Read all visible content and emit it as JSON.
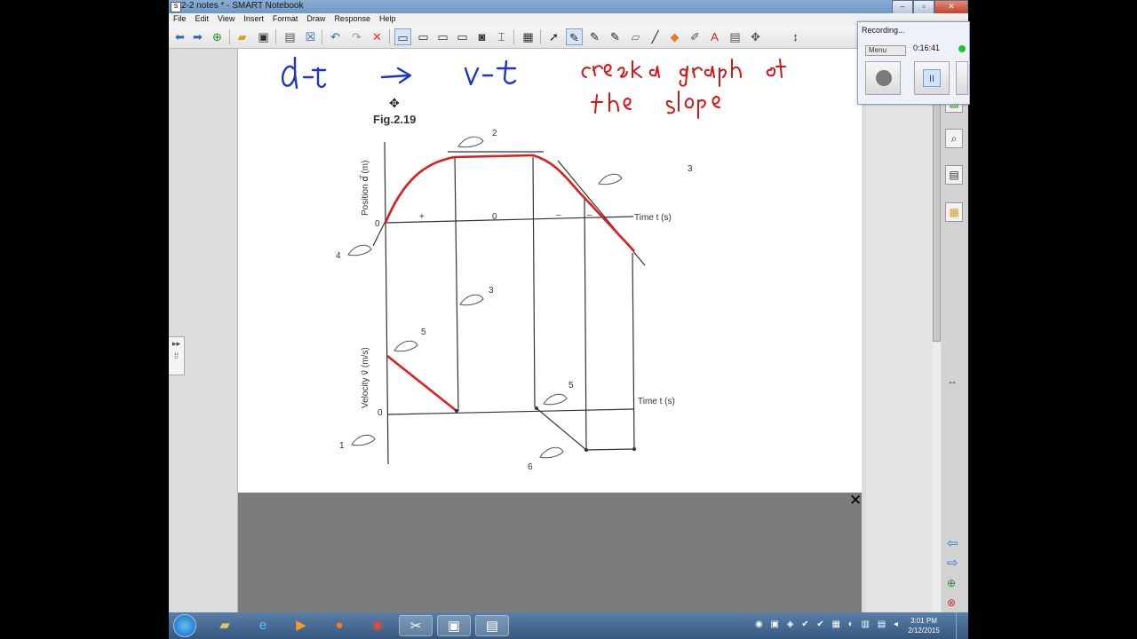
{
  "window": {
    "title": "2-2 notes * - SMART Notebook",
    "controls": {
      "minimize": "–",
      "maximize": "▫",
      "close": "✕"
    }
  },
  "menu": [
    "File",
    "Edit",
    "View",
    "Insert",
    "Format",
    "Draw",
    "Response",
    "Help"
  ],
  "toolbar_icons": [
    "back-arrow-icon",
    "forward-arrow-icon",
    "add-page-icon",
    "open-folder-icon",
    "save-icon",
    "paste-icon",
    "delete-page-icon",
    "undo-icon",
    "redo-icon",
    "delete-icon",
    "screen-shade-icon",
    "full-screen-icon",
    "dual-display-icon",
    "show-hide-icon",
    "screen-capture-icon",
    "document-camera-icon",
    "table-icon",
    "select-icon",
    "pen-icon",
    "creative-pen-icon",
    "magic-pen-icon",
    "eraser-icon",
    "line-icon",
    "shape-icon",
    "fill-icon",
    "text-icon",
    "properties-icon",
    "move-toolbar-icon"
  ],
  "handwriting": {
    "title": "d-t → v-t",
    "note_line1": "create a graph of",
    "note_line2": "the slope"
  },
  "figure": {
    "label": "Fig.2.19",
    "position_axis_label": "Position d⃗ (m)",
    "velocity_axis_label": "Velocity v⃗ (m/s)",
    "time_label_top": "Time t (s)",
    "time_label_bottom": "Time t (s)",
    "zero_top": "0",
    "zero_bottom": "0",
    "sign_plus": "+",
    "sign_zero": "0",
    "sign_minus1": "–",
    "sign_minus2": "–",
    "callouts": [
      "1",
      "2",
      "3",
      "4",
      "4",
      "5",
      "5",
      "6"
    ],
    "colors": {
      "ink_blue": "#1f33c8",
      "ink_red": "#d41616",
      "trace_red": "#dc1e1e"
    }
  },
  "recorder": {
    "title": "Recording...",
    "menu_label": "Menu",
    "elapsed": "0:16:41",
    "pause_glyph": "II"
  },
  "taskbar": {
    "time": "3:01 PM",
    "date": "2/12/2015",
    "apps": [
      "file-explorer-icon",
      "internet-explorer-icon",
      "media-player-icon",
      "firefox-icon",
      "chrome-icon",
      "snipping-tool-icon",
      "network-app-icon",
      "smart-notebook-icon"
    ]
  },
  "panel": {
    "resize_glyph": "↔",
    "prev_page": "🡐",
    "next_page": "🡒"
  }
}
